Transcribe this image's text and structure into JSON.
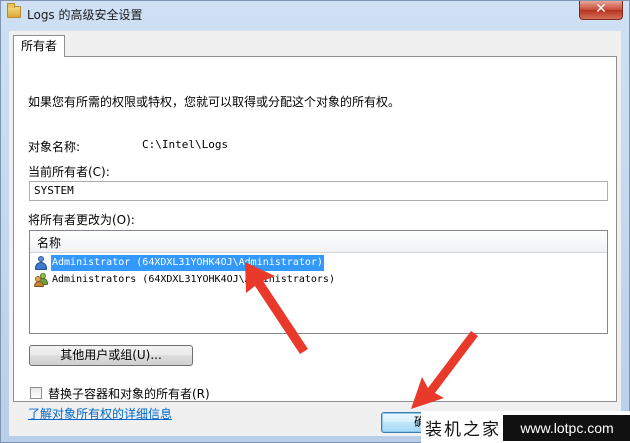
{
  "window": {
    "title": "Logs 的高级安全设置",
    "close_glyph": "✕"
  },
  "tab": {
    "label": "所有者"
  },
  "intro_text": "如果您有所需的权限或特权，您就可以取得或分配这个对象的所有权。",
  "object_name": {
    "label": "对象名称:",
    "value": "C:\\Intel\\Logs"
  },
  "current_owner": {
    "label": "当前所有者(C):",
    "value": "SYSTEM"
  },
  "change_owner": {
    "label": "将所有者更改为(O):"
  },
  "owner_list": {
    "column_header": "名称",
    "rows": [
      {
        "icon": "user-icon",
        "text": "Administrator (64XDXL31YOHK4OJ\\Administrator)",
        "selected": true
      },
      {
        "icon": "group-icon",
        "text": "Administrators (64XDXL31YOHK4OJ\\Administrators)",
        "selected": false
      }
    ]
  },
  "other_users_button": "其他用户或组(U)...",
  "replace_checkbox": {
    "label": "替换子容器和对象的所有者(R)",
    "checked": false
  },
  "learn_link": "了解对象所有权的详细信息",
  "ok_button": "确",
  "watermark": {
    "site_name": "装机之家",
    "url": "www.lotpc.com"
  },
  "colors": {
    "selection": "#3399ff",
    "link": "#0066cc",
    "annotation_arrow": "#e8392b"
  }
}
